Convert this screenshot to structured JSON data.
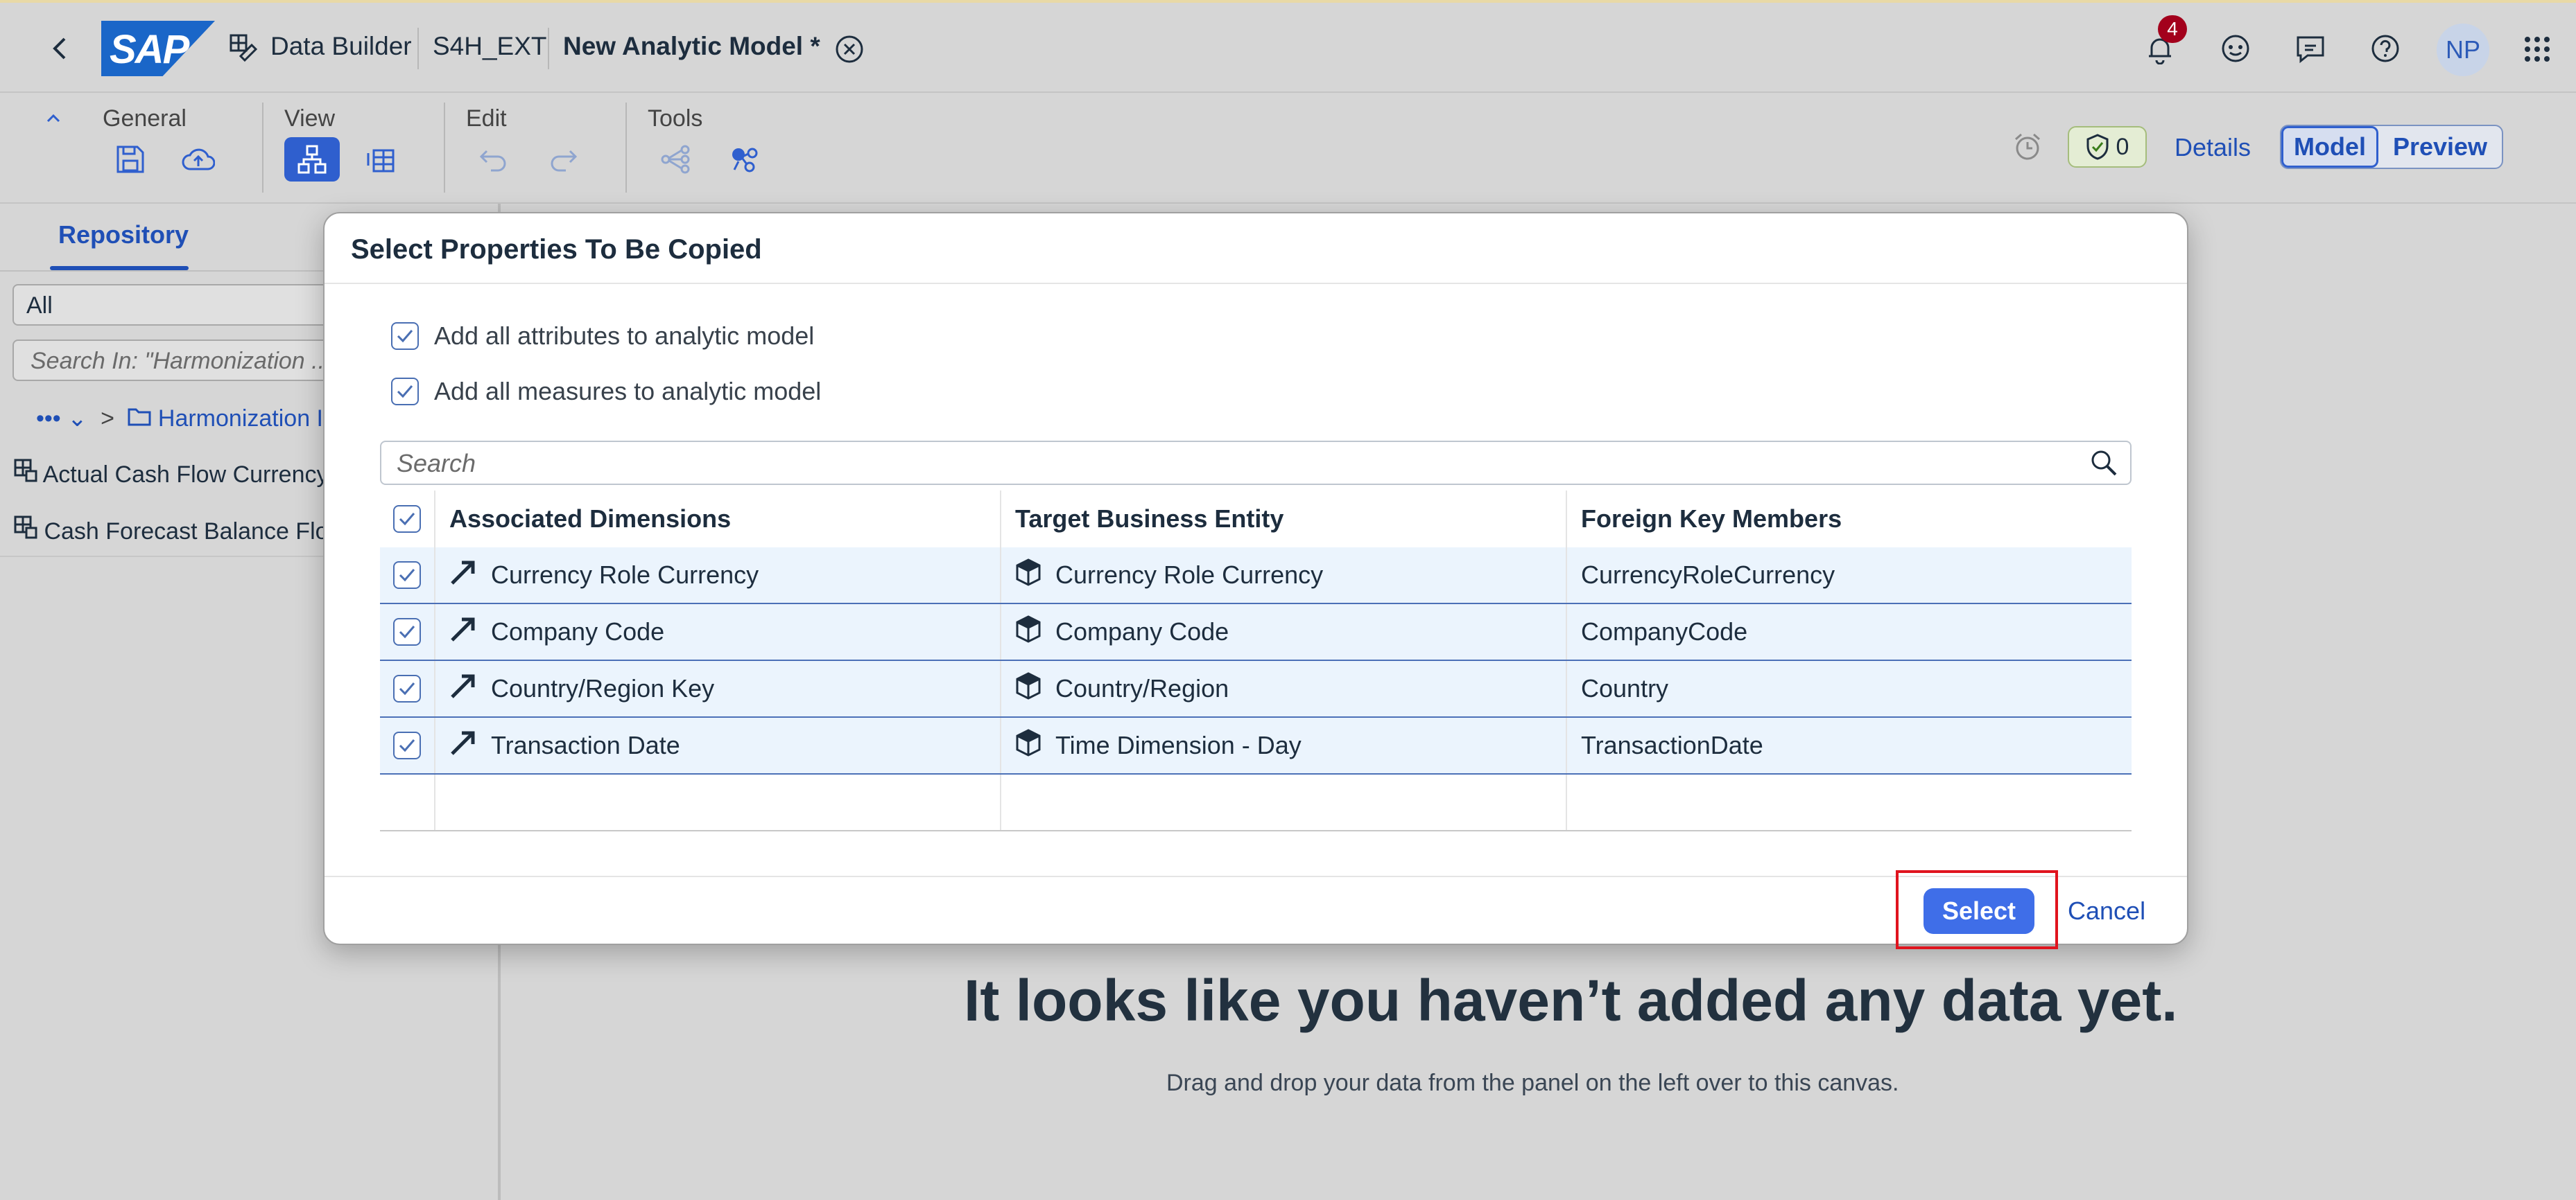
{
  "shell": {
    "app_name": "Data Builder",
    "space": "S4H_EXT",
    "model_title": "New Analytic Model",
    "dirty_marker": "*",
    "notification_count": "4",
    "avatar_initials": "NP",
    "logo_text": "SAP"
  },
  "toolbar": {
    "groups": {
      "general": "General",
      "view": "View",
      "edit": "Edit",
      "tools": "Tools"
    },
    "status_count": "0",
    "details_label": "Details",
    "model_label": "Model",
    "preview_label": "Preview"
  },
  "left_panel": {
    "tab_label": "Repository",
    "filter_value": "All",
    "search_placeholder": "Search In: \"Harmonization ...",
    "breadcrumb_more": "•••",
    "breadcrumb_folder": "Harmonization I",
    "items": [
      {
        "label": "Actual Cash Flow Currency"
      },
      {
        "label": "Cash Forecast Balance Flo"
      }
    ]
  },
  "canvas": {
    "empty_title": "It looks like you haven’t added any data yet.",
    "empty_subtitle": "Drag and drop your data from the panel on the left over to this canvas."
  },
  "dialog": {
    "title": "Select Properties To Be Copied",
    "option_attributes": "Add all attributes to analytic model",
    "option_measures": "Add all measures to analytic model",
    "search_placeholder": "Search",
    "columns": [
      "Associated Dimensions",
      "Target Business Entity",
      "Foreign Key Members"
    ],
    "rows": [
      {
        "dimension": "Currency Role Currency",
        "entity": "Currency Role Currency",
        "fk": "CurrencyRoleCurrency"
      },
      {
        "dimension": "Company Code",
        "entity": "Company Code",
        "fk": "CompanyCode"
      },
      {
        "dimension": "Country/Region Key",
        "entity": "Country/Region",
        "fk": "Country"
      },
      {
        "dimension": "Transaction Date",
        "entity": "Time Dimension - Day",
        "fk": "TransactionDate"
      }
    ],
    "select_label": "Select",
    "cancel_label": "Cancel"
  }
}
